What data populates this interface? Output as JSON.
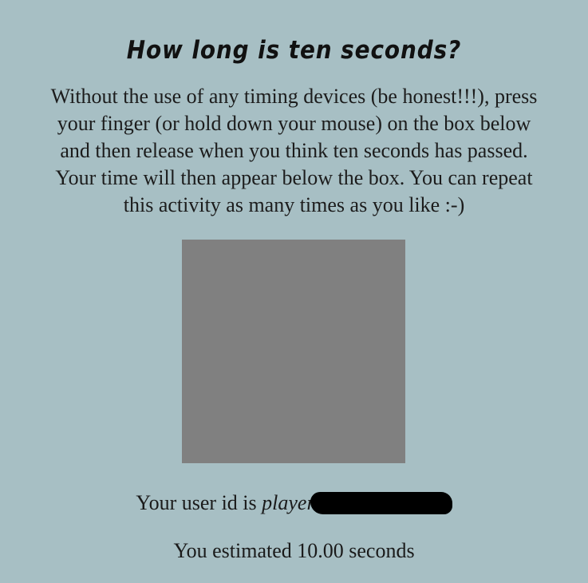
{
  "header": {
    "title": "How long is ten seconds?"
  },
  "instructions": {
    "lines": [
      "Without the use of any timing devices (be honest!!!), press",
      "your finger (or hold down your mouse) on the box below",
      "and then release when you think ten seconds has passed.",
      "Your time will then appear below the box. You can repeat",
      "this activity as many times as you like :-)"
    ]
  },
  "timer_box": {
    "color": "#808080"
  },
  "user": {
    "prefix": "Your user id is ",
    "id_visible": "player"
  },
  "result": {
    "text": "You estimated 10.00 seconds"
  },
  "colors": {
    "background": "#a7bfc4",
    "box": "#808080",
    "text": "#1a1a1a"
  }
}
